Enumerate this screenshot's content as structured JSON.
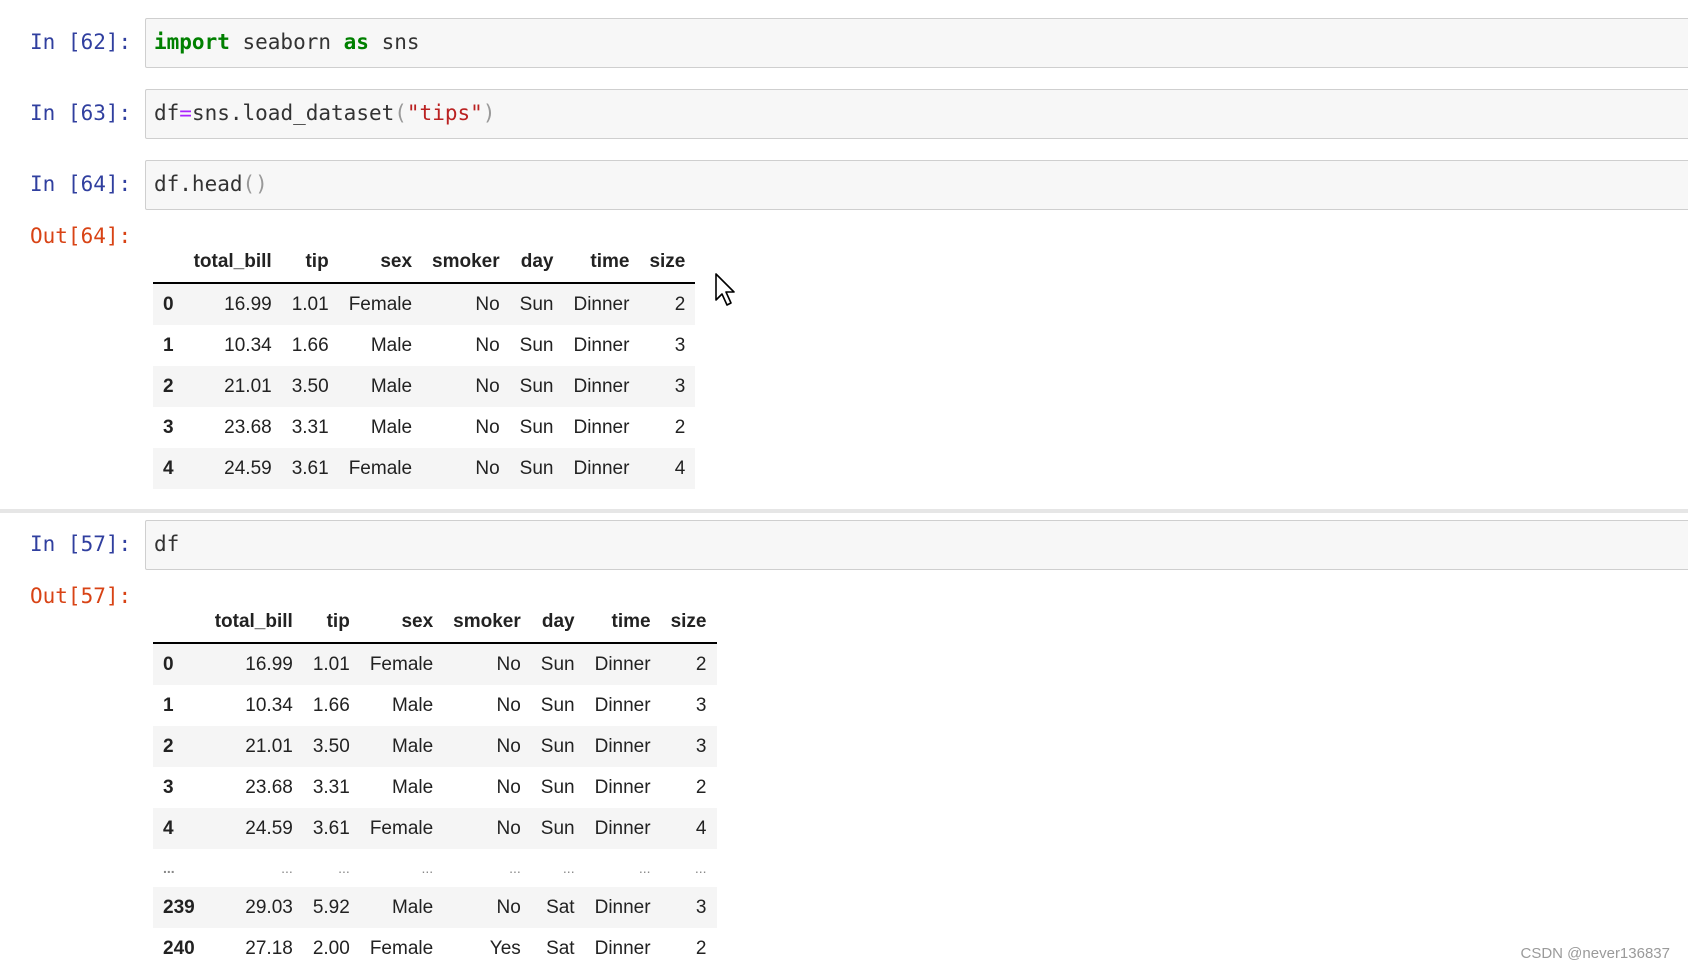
{
  "cells": [
    {
      "prompt": "In [62]:",
      "code": {
        "kw1": "import",
        "mid": " seaborn ",
        "kw2": "as",
        "end": " sns"
      }
    },
    {
      "prompt": "In [63]:",
      "code": {
        "pre": "df",
        "op": "=",
        "mid": "sns.load_dataset",
        "lp": "(",
        "str": "\"tips\"",
        "rp": ")"
      }
    },
    {
      "prompt": "In [64]:",
      "code": {
        "pre": "df.head",
        "lp": "(",
        "rp": ")"
      },
      "out_prompt": "Out[64]:",
      "table": {
        "columns": [
          "",
          "total_bill",
          "tip",
          "sex",
          "smoker",
          "day",
          "time",
          "size"
        ],
        "rows": [
          [
            "0",
            "16.99",
            "1.01",
            "Female",
            "No",
            "Sun",
            "Dinner",
            "2"
          ],
          [
            "1",
            "10.34",
            "1.66",
            "Male",
            "No",
            "Sun",
            "Dinner",
            "3"
          ],
          [
            "2",
            "21.01",
            "3.50",
            "Male",
            "No",
            "Sun",
            "Dinner",
            "3"
          ],
          [
            "3",
            "23.68",
            "3.31",
            "Male",
            "No",
            "Sun",
            "Dinner",
            "2"
          ],
          [
            "4",
            "24.59",
            "3.61",
            "Female",
            "No",
            "Sun",
            "Dinner",
            "4"
          ]
        ]
      }
    },
    {
      "prompt": "In [57]:",
      "code": {
        "pre": "df"
      },
      "out_prompt": "Out[57]:",
      "table": {
        "columns": [
          "",
          "total_bill",
          "tip",
          "sex",
          "smoker",
          "day",
          "time",
          "size"
        ],
        "rows": [
          [
            "0",
            "16.99",
            "1.01",
            "Female",
            "No",
            "Sun",
            "Dinner",
            "2"
          ],
          [
            "1",
            "10.34",
            "1.66",
            "Male",
            "No",
            "Sun",
            "Dinner",
            "3"
          ],
          [
            "2",
            "21.01",
            "3.50",
            "Male",
            "No",
            "Sun",
            "Dinner",
            "3"
          ],
          [
            "3",
            "23.68",
            "3.31",
            "Male",
            "No",
            "Sun",
            "Dinner",
            "2"
          ],
          [
            "4",
            "24.59",
            "3.61",
            "Female",
            "No",
            "Sun",
            "Dinner",
            "4"
          ],
          [
            "...",
            "...",
            "...",
            "...",
            "...",
            "...",
            "...",
            "..."
          ],
          [
            "239",
            "29.03",
            "5.92",
            "Male",
            "No",
            "Sat",
            "Dinner",
            "3"
          ],
          [
            "240",
            "27.18",
            "2.00",
            "Female",
            "Yes",
            "Sat",
            "Dinner",
            "2"
          ]
        ]
      }
    }
  ],
  "watermark": "CSDN @never136837",
  "icons": {
    "cursor": "mouse-pointer-icon"
  }
}
